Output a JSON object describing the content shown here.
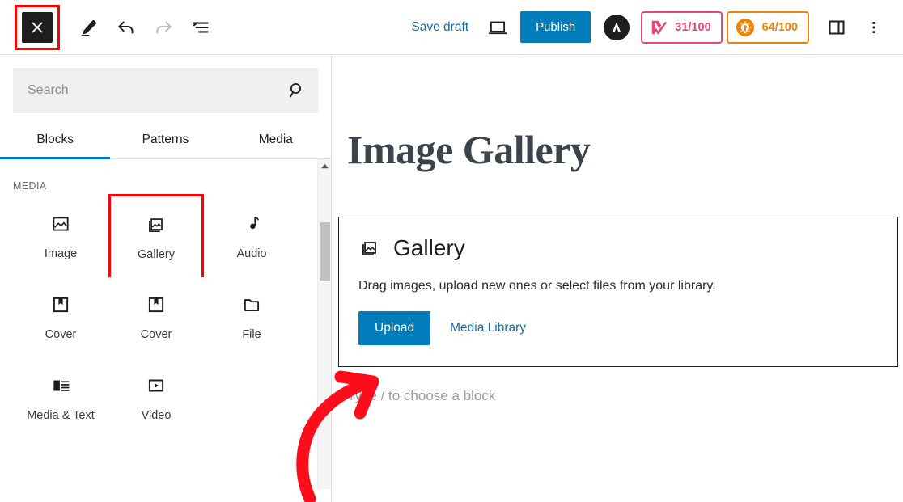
{
  "toolbar": {
    "inserter_label": "Close block inserter",
    "edit_label": "Edit",
    "undo_label": "Undo",
    "redo_label": "Redo",
    "list_view_label": "Document overview",
    "save_draft_label": "Save draft",
    "preview_label": "Preview",
    "publish_label": "Publish",
    "logo_label": "AIOSEO",
    "badges": [
      {
        "name": "monsterinsights-score",
        "value": "31/100",
        "color": "#e8457a"
      },
      {
        "name": "seo-score",
        "value": "64/100",
        "color": "#f18200"
      }
    ],
    "settings_label": "Settings",
    "options_label": "Options"
  },
  "sidebar": {
    "search": {
      "placeholder": "Search",
      "value": "",
      "icon": "search-icon"
    },
    "tabs": [
      {
        "label": "Blocks",
        "active": true
      },
      {
        "label": "Patterns",
        "active": false
      },
      {
        "label": "Media",
        "active": false
      }
    ],
    "category": "MEDIA",
    "blocks": [
      {
        "label": "Image",
        "icon": "image-icon",
        "highlighted": false
      },
      {
        "label": "Gallery",
        "icon": "gallery-icon",
        "highlighted": true
      },
      {
        "label": "Audio",
        "icon": "audio-icon",
        "highlighted": false
      },
      {
        "label": "Cover",
        "icon": "cover-icon",
        "highlighted": false
      },
      {
        "label": "Cover",
        "icon": "cover-icon",
        "highlighted": false
      },
      {
        "label": "File",
        "icon": "file-icon",
        "highlighted": false
      },
      {
        "label": "Media & Text",
        "icon": "media-text-icon",
        "highlighted": false
      },
      {
        "label": "Video",
        "icon": "video-icon",
        "highlighted": false
      }
    ]
  },
  "editor": {
    "post_title": "Image Gallery",
    "gallery_block": {
      "icon": "gallery-icon",
      "title": "Gallery",
      "description": "Drag images, upload new ones or select files from your library.",
      "upload_label": "Upload",
      "media_library_label": "Media Library"
    },
    "empty_paragraph_placeholder": "Type / to choose a block"
  },
  "annotation": {
    "arrow_color": "#fc0d1b",
    "points_to": "Upload"
  }
}
